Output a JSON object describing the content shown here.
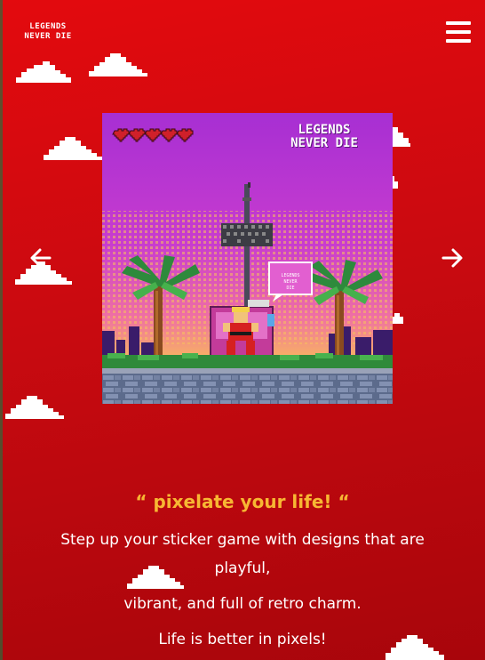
{
  "header": {
    "logo_text": "LEGENDS NEVER DIE",
    "menu_icon": "hamburger-menu-icon"
  },
  "carousel": {
    "prev_icon": "arrow-left-icon",
    "next_icon": "arrow-right-icon",
    "slide": {
      "title": "LEGENDS NEVER DIE",
      "speech_bubble_text": "LEGENDS NEVER DIE",
      "hearts": 5
    }
  },
  "tagline": "“ pixelate your life! “",
  "description_lines": [
    "Step up your sticker game with designs that are",
    "playful,",
    "vibrant, and full of retro charm.",
    "Life is better in pixels!"
  ],
  "colors": {
    "background": "#d8090e",
    "accent_quote": "#f7b733",
    "art_sky": "#a72fd3"
  }
}
